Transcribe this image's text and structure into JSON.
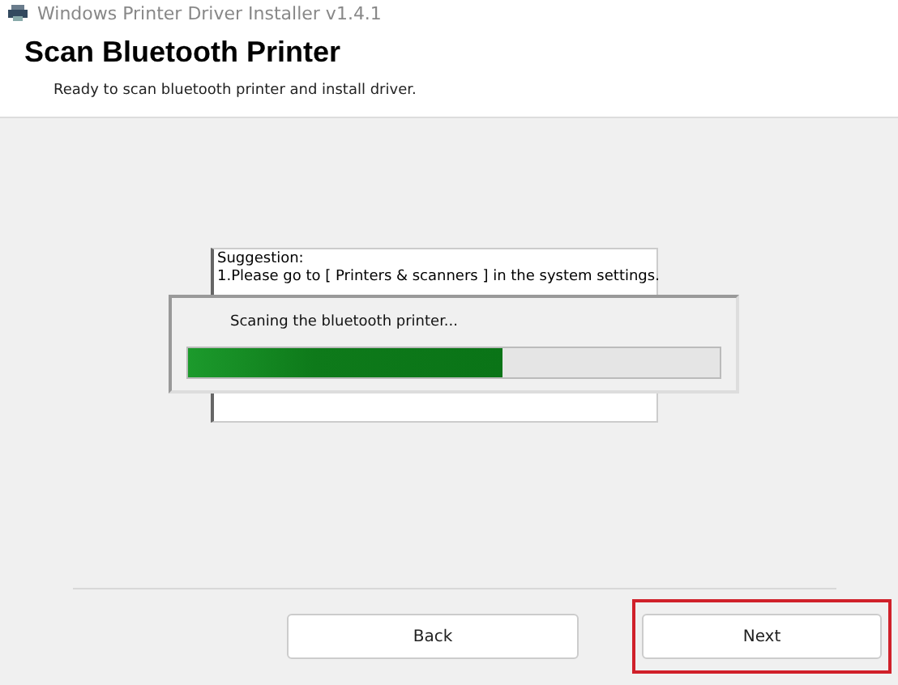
{
  "window": {
    "title": "Windows Printer Driver Installer v1.4.1"
  },
  "header": {
    "title": "Scan Bluetooth Printer",
    "subtitle": "Ready to scan bluetooth printer and install driver."
  },
  "suggestion": {
    "lines": [
      "Suggestion:",
      "1.Please go to [ Printers & scanners ] in the system settings."
    ]
  },
  "progress_dialog": {
    "message": "Scaning the bluetooth printer...",
    "level": 0.59
  },
  "buttons": [
    {
      "label": "Back",
      "highlighted": false
    },
    {
      "label": "Next",
      "highlighted": true
    }
  ]
}
